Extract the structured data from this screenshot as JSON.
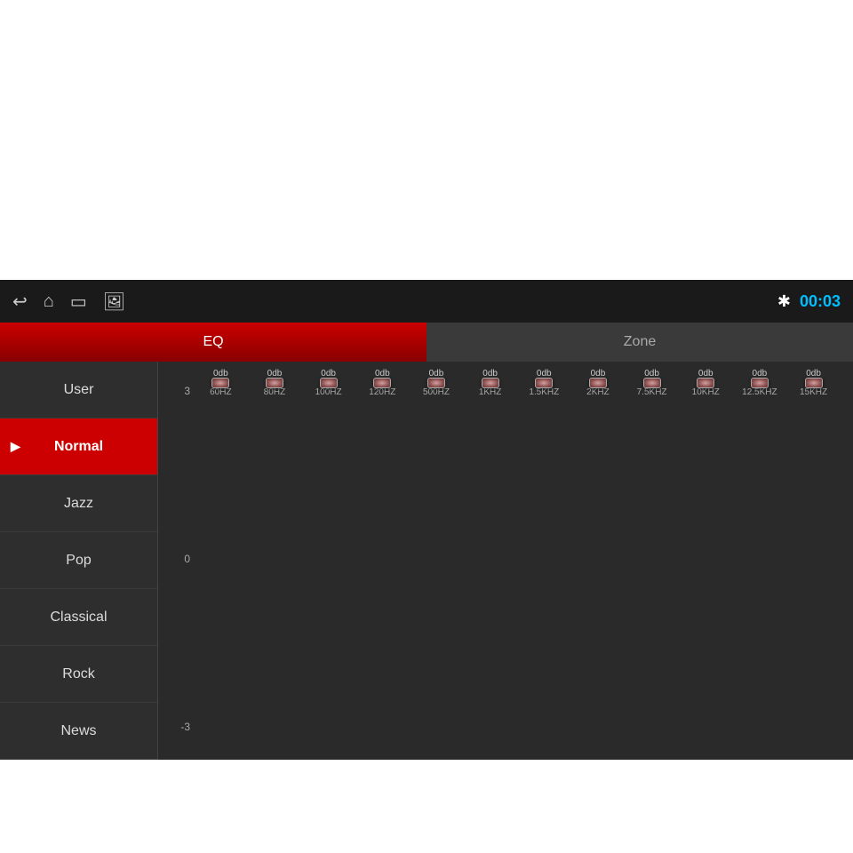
{
  "topbar": {
    "time": "00:03",
    "icons": {
      "back": "↩",
      "home": "⌂",
      "screen": "▭",
      "image": "🖼"
    }
  },
  "tabs": [
    {
      "id": "eq",
      "label": "EQ",
      "active": true
    },
    {
      "id": "zone",
      "label": "Zone",
      "active": false
    }
  ],
  "sidebar": {
    "items": [
      {
        "id": "user",
        "label": "User",
        "active": false
      },
      {
        "id": "normal",
        "label": "Normal",
        "active": true
      },
      {
        "id": "jazz",
        "label": "Jazz",
        "active": false
      },
      {
        "id": "pop",
        "label": "Pop",
        "active": false
      },
      {
        "id": "classical",
        "label": "Classical",
        "active": false
      },
      {
        "id": "rock",
        "label": "Rock",
        "active": false
      },
      {
        "id": "news",
        "label": "News",
        "active": false
      }
    ]
  },
  "eq": {
    "y_labels": [
      "3",
      "0",
      "-3"
    ],
    "bands": [
      {
        "freq": "60HZ",
        "value": "0db"
      },
      {
        "freq": "80HZ",
        "value": "0db"
      },
      {
        "freq": "100HZ",
        "value": "0db"
      },
      {
        "freq": "120HZ",
        "value": "0db"
      },
      {
        "freq": "500HZ",
        "value": "0db"
      },
      {
        "freq": "1KHZ",
        "value": "0db"
      },
      {
        "freq": "1.5KHZ",
        "value": "0db"
      },
      {
        "freq": "2KHZ",
        "value": "0db"
      },
      {
        "freq": "7.5KHZ",
        "value": "0db"
      },
      {
        "freq": "10KHZ",
        "value": "0db"
      },
      {
        "freq": "12.5KHZ",
        "value": "0db"
      },
      {
        "freq": "15KHZ",
        "value": "0db"
      }
    ]
  }
}
